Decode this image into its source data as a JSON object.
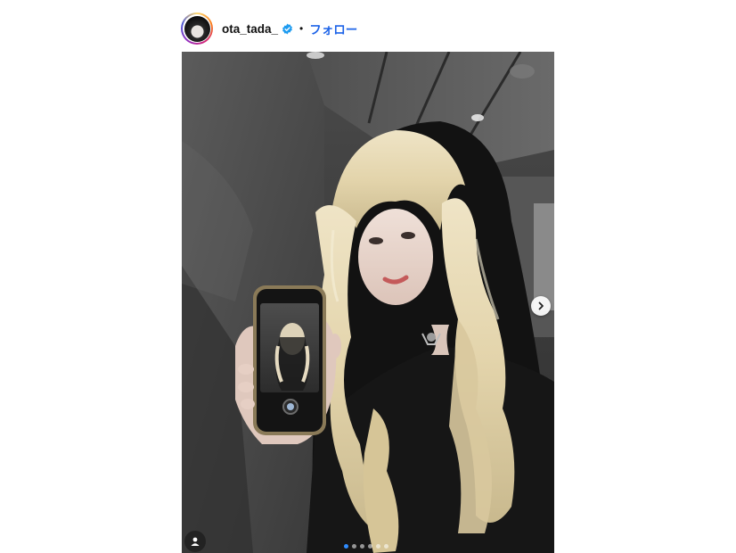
{
  "post": {
    "username": "ota_tada_",
    "separator": "•",
    "follow_label": "フォロー",
    "verified": true,
    "carousel": {
      "total": 6,
      "current": 1
    }
  },
  "icons": {
    "verified": "verified-badge-icon",
    "next": "chevron-right-icon",
    "user_tag": "person-icon"
  },
  "colors": {
    "follow": "#1e64e8",
    "verified": "#1d9bf0",
    "active_dot": "#2f8cff"
  }
}
